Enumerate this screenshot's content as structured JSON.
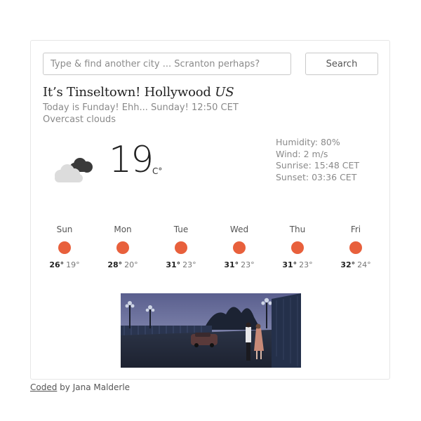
{
  "search": {
    "placeholder": "Type & find another city ... Scranton perhaps?",
    "value": "",
    "button_label": "Search"
  },
  "location": {
    "prefix": "It’s Tinseltown! Hollywood",
    "country": "US"
  },
  "date_line": "Today is Funday! Ehh... Sunday! 12:50 CET",
  "description": "Overcast clouds",
  "current": {
    "icon": "overcast-clouds-icon",
    "temperature": "19",
    "unit": "C°"
  },
  "stats": {
    "humidity": "Humidity: 80%",
    "wind": "Wind: 2 m/s",
    "sunrise": "Sunrise: 15:48 CET",
    "sunset": "Sunset: 03:36 CET"
  },
  "forecast": [
    {
      "day": "Sun",
      "max": "26°",
      "min": "19°"
    },
    {
      "day": "Mon",
      "max": "28°",
      "min": "20°"
    },
    {
      "day": "Tue",
      "max": "31°",
      "min": "23°"
    },
    {
      "day": "Wed",
      "max": "31°",
      "min": "23°"
    },
    {
      "day": "Thu",
      "max": "31°",
      "min": "23°"
    },
    {
      "day": "Fri",
      "max": "32°",
      "min": "24°"
    }
  ],
  "forecast_icon_color": "#e8603c",
  "gif": {
    "icon": "la-la-land-bridge-scene-image"
  },
  "footer": {
    "link_text": "Coded",
    "rest": " by Jana Malderle"
  }
}
